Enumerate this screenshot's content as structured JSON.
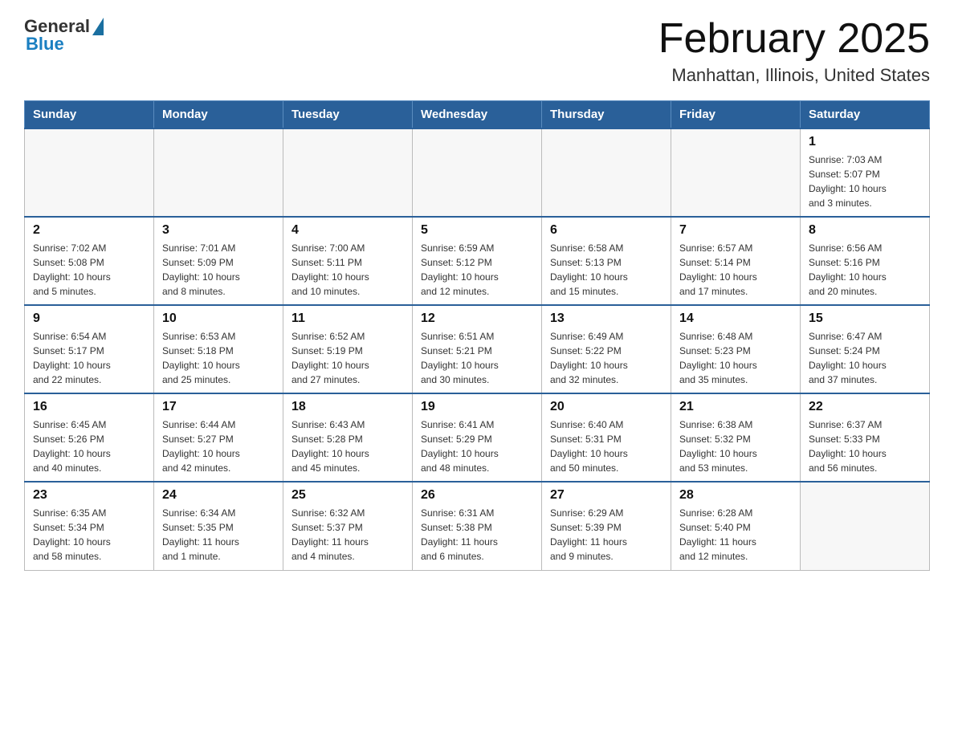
{
  "header": {
    "logo_general": "General",
    "logo_blue": "Blue",
    "month_title": "February 2025",
    "location": "Manhattan, Illinois, United States"
  },
  "weekdays": [
    "Sunday",
    "Monday",
    "Tuesday",
    "Wednesday",
    "Thursday",
    "Friday",
    "Saturday"
  ],
  "weeks": [
    [
      {
        "day": "",
        "info": ""
      },
      {
        "day": "",
        "info": ""
      },
      {
        "day": "",
        "info": ""
      },
      {
        "day": "",
        "info": ""
      },
      {
        "day": "",
        "info": ""
      },
      {
        "day": "",
        "info": ""
      },
      {
        "day": "1",
        "info": "Sunrise: 7:03 AM\nSunset: 5:07 PM\nDaylight: 10 hours\nand 3 minutes."
      }
    ],
    [
      {
        "day": "2",
        "info": "Sunrise: 7:02 AM\nSunset: 5:08 PM\nDaylight: 10 hours\nand 5 minutes."
      },
      {
        "day": "3",
        "info": "Sunrise: 7:01 AM\nSunset: 5:09 PM\nDaylight: 10 hours\nand 8 minutes."
      },
      {
        "day": "4",
        "info": "Sunrise: 7:00 AM\nSunset: 5:11 PM\nDaylight: 10 hours\nand 10 minutes."
      },
      {
        "day": "5",
        "info": "Sunrise: 6:59 AM\nSunset: 5:12 PM\nDaylight: 10 hours\nand 12 minutes."
      },
      {
        "day": "6",
        "info": "Sunrise: 6:58 AM\nSunset: 5:13 PM\nDaylight: 10 hours\nand 15 minutes."
      },
      {
        "day": "7",
        "info": "Sunrise: 6:57 AM\nSunset: 5:14 PM\nDaylight: 10 hours\nand 17 minutes."
      },
      {
        "day": "8",
        "info": "Sunrise: 6:56 AM\nSunset: 5:16 PM\nDaylight: 10 hours\nand 20 minutes."
      }
    ],
    [
      {
        "day": "9",
        "info": "Sunrise: 6:54 AM\nSunset: 5:17 PM\nDaylight: 10 hours\nand 22 minutes."
      },
      {
        "day": "10",
        "info": "Sunrise: 6:53 AM\nSunset: 5:18 PM\nDaylight: 10 hours\nand 25 minutes."
      },
      {
        "day": "11",
        "info": "Sunrise: 6:52 AM\nSunset: 5:19 PM\nDaylight: 10 hours\nand 27 minutes."
      },
      {
        "day": "12",
        "info": "Sunrise: 6:51 AM\nSunset: 5:21 PM\nDaylight: 10 hours\nand 30 minutes."
      },
      {
        "day": "13",
        "info": "Sunrise: 6:49 AM\nSunset: 5:22 PM\nDaylight: 10 hours\nand 32 minutes."
      },
      {
        "day": "14",
        "info": "Sunrise: 6:48 AM\nSunset: 5:23 PM\nDaylight: 10 hours\nand 35 minutes."
      },
      {
        "day": "15",
        "info": "Sunrise: 6:47 AM\nSunset: 5:24 PM\nDaylight: 10 hours\nand 37 minutes."
      }
    ],
    [
      {
        "day": "16",
        "info": "Sunrise: 6:45 AM\nSunset: 5:26 PM\nDaylight: 10 hours\nand 40 minutes."
      },
      {
        "day": "17",
        "info": "Sunrise: 6:44 AM\nSunset: 5:27 PM\nDaylight: 10 hours\nand 42 minutes."
      },
      {
        "day": "18",
        "info": "Sunrise: 6:43 AM\nSunset: 5:28 PM\nDaylight: 10 hours\nand 45 minutes."
      },
      {
        "day": "19",
        "info": "Sunrise: 6:41 AM\nSunset: 5:29 PM\nDaylight: 10 hours\nand 48 minutes."
      },
      {
        "day": "20",
        "info": "Sunrise: 6:40 AM\nSunset: 5:31 PM\nDaylight: 10 hours\nand 50 minutes."
      },
      {
        "day": "21",
        "info": "Sunrise: 6:38 AM\nSunset: 5:32 PM\nDaylight: 10 hours\nand 53 minutes."
      },
      {
        "day": "22",
        "info": "Sunrise: 6:37 AM\nSunset: 5:33 PM\nDaylight: 10 hours\nand 56 minutes."
      }
    ],
    [
      {
        "day": "23",
        "info": "Sunrise: 6:35 AM\nSunset: 5:34 PM\nDaylight: 10 hours\nand 58 minutes."
      },
      {
        "day": "24",
        "info": "Sunrise: 6:34 AM\nSunset: 5:35 PM\nDaylight: 11 hours\nand 1 minute."
      },
      {
        "day": "25",
        "info": "Sunrise: 6:32 AM\nSunset: 5:37 PM\nDaylight: 11 hours\nand 4 minutes."
      },
      {
        "day": "26",
        "info": "Sunrise: 6:31 AM\nSunset: 5:38 PM\nDaylight: 11 hours\nand 6 minutes."
      },
      {
        "day": "27",
        "info": "Sunrise: 6:29 AM\nSunset: 5:39 PM\nDaylight: 11 hours\nand 9 minutes."
      },
      {
        "day": "28",
        "info": "Sunrise: 6:28 AM\nSunset: 5:40 PM\nDaylight: 11 hours\nand 12 minutes."
      },
      {
        "day": "",
        "info": ""
      }
    ]
  ]
}
